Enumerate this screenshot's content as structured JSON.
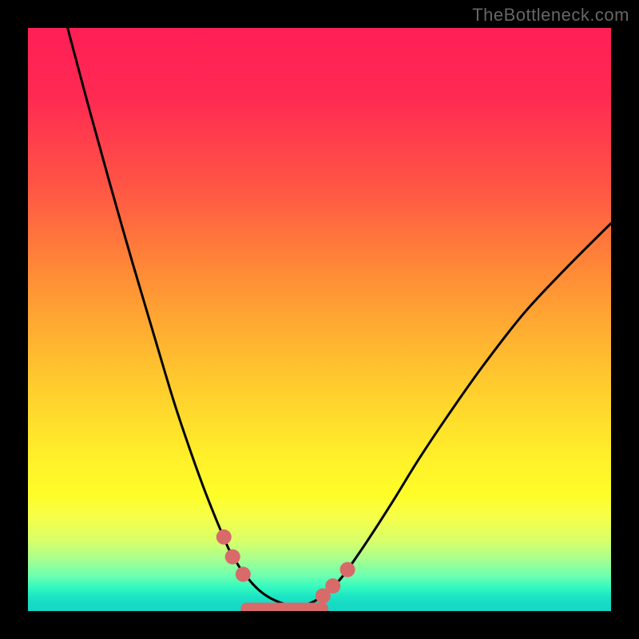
{
  "attribution": "TheBottleneck.com",
  "chart_data": {
    "type": "line",
    "title": "",
    "xlabel": "",
    "ylabel": "",
    "xlim": [
      0,
      100
    ],
    "ylim": [
      0,
      100
    ],
    "series": [
      {
        "name": "left-curve",
        "x": [
          6.8,
          10.0,
          14.0,
          18.0,
          22.0,
          25.0,
          27.5,
          30.0,
          32.0,
          33.5,
          34.5,
          35.5,
          36.5,
          37.5,
          38.5,
          39.5,
          40.5,
          42.0,
          44.0,
          46.0
        ],
        "values": [
          100.0,
          88.0,
          73.5,
          59.5,
          46.0,
          36.0,
          28.5,
          21.5,
          16.4,
          12.8,
          10.5,
          8.8,
          7.2,
          5.9,
          4.7,
          3.7,
          2.9,
          2.0,
          1.2,
          0.8
        ]
      },
      {
        "name": "right-curve",
        "x": [
          46.0,
          48.0,
          50.0,
          52.0,
          54.0,
          56.5,
          59.5,
          63.0,
          67.0,
          72.0,
          78.0,
          85.0,
          92.0,
          100.0
        ],
        "values": [
          0.8,
          1.2,
          2.2,
          3.8,
          6.0,
          9.5,
          14.0,
          19.5,
          26.0,
          33.5,
          42.0,
          51.0,
          58.5,
          66.5
        ]
      }
    ],
    "markers": [
      {
        "cluster": "left",
        "x": 33.6,
        "y": 12.7
      },
      {
        "cluster": "left",
        "x": 35.1,
        "y": 9.3
      },
      {
        "cluster": "left",
        "x": 36.9,
        "y": 6.3
      },
      {
        "cluster": "right",
        "x": 50.6,
        "y": 2.6
      },
      {
        "cluster": "right",
        "x": 52.3,
        "y": 4.3
      },
      {
        "cluster": "right",
        "x": 54.8,
        "y": 7.1
      }
    ],
    "valley_band": {
      "x_start": 37.5,
      "x_end": 50.5,
      "y": 0.55
    },
    "colors": {
      "curve": "#000000",
      "marker_fill": "#d86a6a",
      "gradient_top": "#ff1f56",
      "gradient_bottom": "#15d6c6"
    }
  }
}
